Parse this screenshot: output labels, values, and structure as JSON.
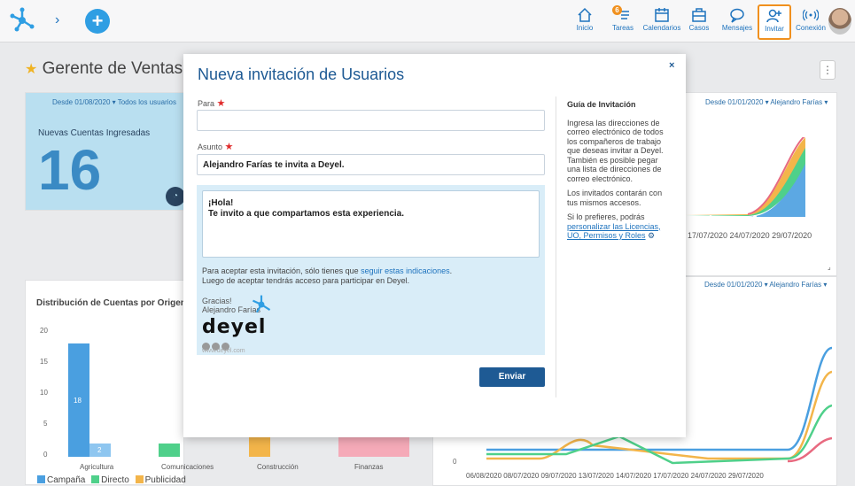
{
  "topbar": {
    "nav": [
      {
        "label": "Inicio",
        "icon": "home-icon"
      },
      {
        "label": "Tareas",
        "icon": "tasks-icon",
        "badge": "6"
      },
      {
        "label": "Calendarios",
        "icon": "calendar-icon"
      },
      {
        "label": "Casos",
        "icon": "briefcase-icon"
      },
      {
        "label": "Mensajes",
        "icon": "chat-icon"
      },
      {
        "label": "Invitar",
        "icon": "invite-user-icon",
        "active": true
      },
      {
        "label": "Conexión",
        "icon": "connection-icon"
      }
    ],
    "accent": "#f0901e"
  },
  "dashboard": {
    "title": "Gerente de Ventas",
    "card1": {
      "filter": "Desde 01/08/2020 ▾  Todos los usuarios",
      "title": "Nuevas Cuentas Ingresadas",
      "value": "16"
    },
    "card2": {
      "filter": "Desde 01/01/2020 ▾  Alejandro Farías ▾",
      "dates": "17/07/2020  24/07/2020  29/07/2020"
    },
    "card3": {
      "title": "Distribución de Cuentas por Origen",
      "y_ticks": [
        "20",
        "15",
        "10",
        "5",
        "0"
      ],
      "categories": [
        "Agricultura",
        "Comunicaciones",
        "Construcción",
        "Finanzas"
      ],
      "bar_label": "18",
      "bar_label_small": "2",
      "legend": [
        "Campaña",
        "Directo",
        "Publicidad"
      ],
      "legend_colors": [
        "#4a9fe0",
        "#4fd08a",
        "#f3b54a"
      ]
    },
    "card4": {
      "filter": "Desde 01/01/2020 ▾  Alejandro Farías ▾",
      "y_zero": "0",
      "dates": "06/08/2020  08/07/2020  09/07/2020  13/07/2020  14/07/2020  17/07/2020  24/07/2020  29/07/2020"
    }
  },
  "modal": {
    "title": "Nueva invitación de Usuarios",
    "close": "×",
    "to_label": "Para",
    "to_value": "",
    "subject_label": "Asunto",
    "subject_value": "Alejandro Farías te invita a Deyel.",
    "required_mark": "★",
    "message_line1": "¡Hola!",
    "message_line2": "Te invito a que compartamos esta experiencia.",
    "accept_pre": "Para aceptar esta invitación, sólo tienes que ",
    "accept_link": "seguir estas indicaciones",
    "accept_post": ".",
    "accept_line2": "Luego de aceptar tendrás acceso para participar en Deyel.",
    "signoff": "Gracias!",
    "signer": "Alejandro Farías",
    "brand": "deyel",
    "site": "www.deyel.com",
    "send": "Enviar"
  },
  "guide": {
    "title": "Guía de Invitación",
    "p1": "Ingresa las direcciones de correo electrónico de todos los compañeros de trabajo que deseas invitar a Deyel. También es posible pegar una lista de direcciones de correo electrónico.",
    "p2": "Los invitados contarán con tus mismos accesos.",
    "p3_pre": "Si lo prefieres, podrás ",
    "p3_link": "personalizar las Licencias, UO, Permisos y Roles",
    "gear": "⚙"
  }
}
